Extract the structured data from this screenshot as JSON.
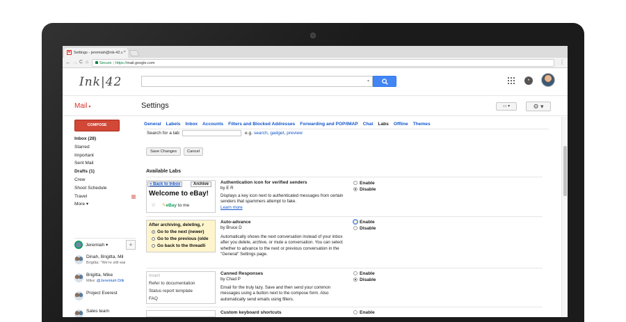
{
  "browser": {
    "tab_title": "Settings - jeremiah@ink-42.c",
    "favicon": "M",
    "tab_close": "×",
    "secure_label": "Secure",
    "url_scheme": "https://",
    "url_rest": "mail.google.com",
    "nav": {
      "back": "←",
      "forward": "→",
      "reload": "C",
      "home": "⌂"
    },
    "menu": "⋮"
  },
  "header": {
    "logo": "Ink|42",
    "search_placeholder": "",
    "search_icon": "search-icon",
    "notification_icon": "N"
  },
  "mailbar": {
    "mail_label": "Mail",
    "caret": "▾",
    "page_title": "Settings",
    "keyboard_icon": "▭ ▾",
    "gear_icon": "⚙ ▾"
  },
  "nav": {
    "compose": "COMPOSE",
    "items": [
      {
        "label": "Inbox (28)",
        "bold": true
      },
      {
        "label": "Starred",
        "bold": false
      },
      {
        "label": "Important",
        "bold": false
      },
      {
        "label": "Sent Mail",
        "bold": false
      },
      {
        "label": "Drafts (1)",
        "bold": true
      },
      {
        "label": "Crew",
        "bold": false
      },
      {
        "label": "Shoot Schedule",
        "bold": false
      },
      {
        "label": "Travel",
        "bold": false
      },
      {
        "label": "More ▾",
        "bold": false
      }
    ],
    "tag_color": "#e7a49b"
  },
  "chat": {
    "me": "Jeremiah ▾",
    "add": "+",
    "contacts": [
      {
        "name": "Dinah, Brigitta, Mil",
        "snippet_prefix": "Brigitta: \"We're still wai",
        "mention": ""
      },
      {
        "name": "Brigitta, Mike",
        "snippet_prefix": "Mike: ",
        "mention": "@Jeremiah Dilk"
      },
      {
        "name": "Project Everest",
        "snippet_prefix": "",
        "mention": ""
      },
      {
        "name": "Sales team",
        "snippet_prefix": "",
        "mention": ""
      }
    ]
  },
  "settings": {
    "tabs": [
      "General",
      "Labels",
      "Inbox",
      "Accounts",
      "Filters and Blocked Addresses",
      "Forwarding and POP/IMAP",
      "Chat",
      "Labs",
      "Offline",
      "Themes"
    ],
    "active_tab": "Labs",
    "search_label": "Search for a lab:",
    "eg_prefix": "e.g.",
    "eg_links": [
      "search",
      "gadget",
      "preview"
    ],
    "save_changes": "Save Changes",
    "cancel": "Cancel",
    "available_labs": "Available Labs",
    "labs": [
      {
        "title": "Authentication icon for verified senders",
        "author": "by E R",
        "desc": "Displays a key icon next to authenticated messages from certain senders that spammers attempt to fake.",
        "link": "Learn more",
        "enable": "Enable",
        "disable": "Disable",
        "selected": "disable",
        "preview": {
          "back": "« Back to Inbox",
          "archive": "Archive",
          "heading": "Welcome to eBay!",
          "sender_brand": "eBay",
          "sender_rest": " to me",
          "star": "☆"
        }
      },
      {
        "title": "Auto-advance",
        "author": "by Bruce D",
        "desc": "Automatically shows the next conversation instead of your inbox after you delete, archive, or mute a conversation. You can select whether to advance to the next or previous conversation in the \"General\" Settings page.",
        "link": "",
        "enable": "Enable",
        "disable": "Disable",
        "selected": "disable",
        "preview": {
          "heading": "After archiving, deleting, r",
          "options": [
            "Go to the next (newer)",
            "Go to the previous (olde",
            "Go back to the threadli"
          ]
        }
      },
      {
        "title": "Canned Responses",
        "author": "by Chad P",
        "desc": "Email for the truly lazy. Save and then send your common messages using a button next to the compose form. Also automatically send emails using filters.",
        "link": "",
        "enable": "Enable",
        "disable": "Disable",
        "selected": "disable",
        "preview": {
          "items": [
            "Insert",
            "Refer to documentation",
            "Status report template",
            "FAQ"
          ]
        }
      },
      {
        "title": "Custom keyboard shortcuts",
        "enable": "Enable"
      }
    ]
  }
}
